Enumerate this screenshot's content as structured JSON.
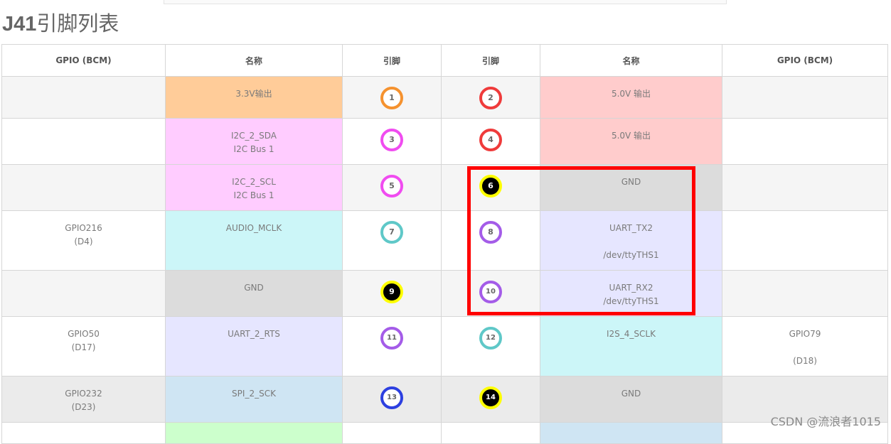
{
  "title_bold": "J41",
  "title_rest": "引脚列表",
  "headers": [
    "GPIO (BCM)",
    "名称",
    "引脚",
    "引脚",
    "名称",
    "GPIO (BCM)"
  ],
  "rows": [
    {
      "gl": "",
      "nl": "3.3V输出",
      "pl": "1",
      "pr": "2",
      "nr": "5.0V 输出",
      "gr": ""
    },
    {
      "gl": "",
      "nl": "I2C_2_SDA\nI2C Bus 1",
      "pl": "3",
      "pr": "4",
      "nr": "5.0V 输出",
      "gr": ""
    },
    {
      "gl": "",
      "nl": "I2C_2_SCL\nI2C Bus 1",
      "pl": "5",
      "pr": "6",
      "nr": "GND",
      "gr": ""
    },
    {
      "gl": "GPIO216\n(D4)",
      "nl": "AUDIO_MCLK",
      "pl": "7",
      "pr": "8",
      "nr": "UART_TX2\n\n/dev/ttyTHS1",
      "gr": ""
    },
    {
      "gl": "",
      "nl": "GND",
      "pl": "9",
      "pr": "10",
      "nr": "UART_RX2\n/dev/ttyTHS1",
      "gr": ""
    },
    {
      "gl": "GPIO50\n(D17)",
      "nl": "UART_2_RTS",
      "pl": "11",
      "pr": "12",
      "nr": "I2S_4_SCLK",
      "gr": "GPIO79\n\n(D18)"
    },
    {
      "gl": "GPIO232\n(D23)",
      "nl": "SPI_2_SCK",
      "pl": "13",
      "pr": "14",
      "nr": "GND",
      "gr": ""
    },
    {
      "gl": "",
      "nl": "",
      "pl": "",
      "pr": "",
      "nr": "",
      "gr": ""
    }
  ],
  "colors": {
    "pin_orange": "#f5922f",
    "pin_red": "#ef3b3b",
    "pin_magenta": "#f04cf0",
    "pin_yellow": "#ffff00",
    "pin_teal": "#5fc8c8",
    "pin_purple": "#a45ce8",
    "pin_blue": "#2c3fe0",
    "highlight": "#ff0000"
  },
  "watermark": "CSDN @流浪者1015"
}
